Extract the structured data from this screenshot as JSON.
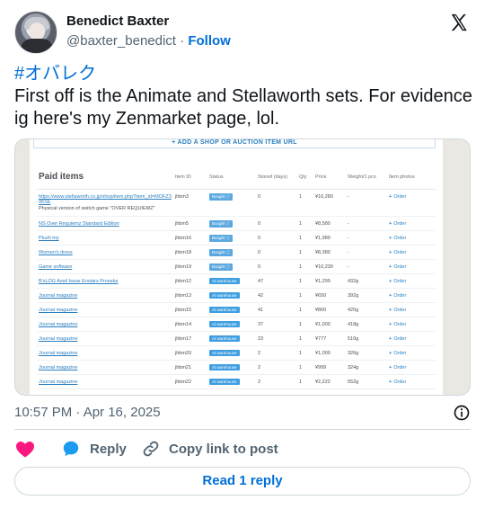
{
  "author": {
    "name": "Benedict Baxter",
    "handle": "@baxter_benedict",
    "separator": " · ",
    "follow_label": "Follow"
  },
  "tweet": {
    "hashtag": "#オバレク",
    "text": "First off is the Animate and Stellaworth sets. For evidence ig here's my Zenmarket page, lol."
  },
  "screenshot": {
    "add_bar": "+ ADD A SHOP OR AUCTION ITEM URL",
    "title": "Paid items",
    "columns": [
      "Item ID",
      "Status",
      "Stored (days)",
      "Qty",
      "Price",
      "Weight/1 pcs",
      "Item photos"
    ],
    "rows": [
      {
        "item": "https://www.stellaworth.co.jp/shop/item.php?item_id=MOFZ395SE",
        "sub": "Physical version of switch game \"OVER REQUIEMZ\"",
        "id": "jhbm3",
        "status": "Bought ⓘ",
        "stored": "0",
        "qty": "1",
        "price": "¥16,280",
        "weight": "-",
        "order": "Order"
      },
      {
        "item": "NS Over Requiemz Standard Edition",
        "sub": "",
        "id": "jhbm5",
        "status": "Bought ⓘ",
        "stored": "0",
        "qty": "1",
        "price": "¥8,580",
        "weight": "-",
        "order": "Order"
      },
      {
        "item": "Plush toy",
        "sub": "",
        "id": "jhbm16",
        "status": "Bought ⓘ",
        "stored": "0",
        "qty": "1",
        "price": "¥1,980",
        "weight": "-",
        "order": "Order"
      },
      {
        "item": "Women's dress",
        "sub": "",
        "id": "jhbm18",
        "status": "Bought ⓘ",
        "stored": "0",
        "qty": "1",
        "price": "¥8,380",
        "weight": "-",
        "order": "Order"
      },
      {
        "item": "Game software",
        "sub": "",
        "id": "jhbm19",
        "status": "Bought ⓘ",
        "stored": "0",
        "qty": "1",
        "price": "¥10,230",
        "weight": "-",
        "order": "Order"
      },
      {
        "item": "B'sLOG Assil Issue Enstars Proseka",
        "sub": "",
        "id": "jhbm12",
        "status": "At warehouse",
        "stored": "47",
        "qty": "1",
        "price": "¥1,299",
        "weight": "432g",
        "order": "Order"
      },
      {
        "item": "Journal magazine",
        "sub": "",
        "id": "jhbm13",
        "status": "At warehouse",
        "stored": "42",
        "qty": "1",
        "price": "¥650",
        "weight": "392g",
        "order": "Order"
      },
      {
        "item": "Journal magazine",
        "sub": "",
        "id": "jhbm15",
        "status": "At warehouse",
        "stored": "41",
        "qty": "1",
        "price": "¥800",
        "weight": "420g",
        "order": "Order"
      },
      {
        "item": "Journal magazine",
        "sub": "",
        "id": "jhbm14",
        "status": "At warehouse",
        "stored": "37",
        "qty": "1",
        "price": "¥1,000",
        "weight": "418g",
        "order": "Order"
      },
      {
        "item": "Journal magazine",
        "sub": "",
        "id": "jhbm17",
        "status": "At warehouse",
        "stored": "23",
        "qty": "1",
        "price": "¥777",
        "weight": "510g",
        "order": "Order"
      },
      {
        "item": "Journal magazine",
        "sub": "",
        "id": "jhbm20",
        "status": "At warehouse",
        "stored": "2",
        "qty": "1",
        "price": "¥1,000",
        "weight": "326g",
        "order": "Order"
      },
      {
        "item": "Journal magazine",
        "sub": "",
        "id": "jhbm21",
        "status": "At warehouse",
        "stored": "2",
        "qty": "1",
        "price": "¥999",
        "weight": "324g",
        "order": "Order"
      },
      {
        "item": "Journal magazine",
        "sub": "",
        "id": "jhbm22",
        "status": "At warehouse",
        "stored": "2",
        "qty": "1",
        "price": "¥2,222",
        "weight": "552g",
        "order": "Order"
      }
    ]
  },
  "meta": {
    "timestamp": "10:57 PM · Apr 16, 2025"
  },
  "actions": {
    "reply_label": "Reply",
    "copy_label": "Copy link to post",
    "read_replies_label": "Read 1 reply"
  },
  "colors": {
    "link": "#006fd6",
    "like": "#f91880",
    "reply_bubble": "#1d9bf0",
    "badge_bought": "#5aa8e0",
    "badge_warehouse": "#3f9fe1"
  },
  "icons": [
    "x-logo-icon",
    "info-icon",
    "heart-icon",
    "reply-icon",
    "link-icon"
  ]
}
